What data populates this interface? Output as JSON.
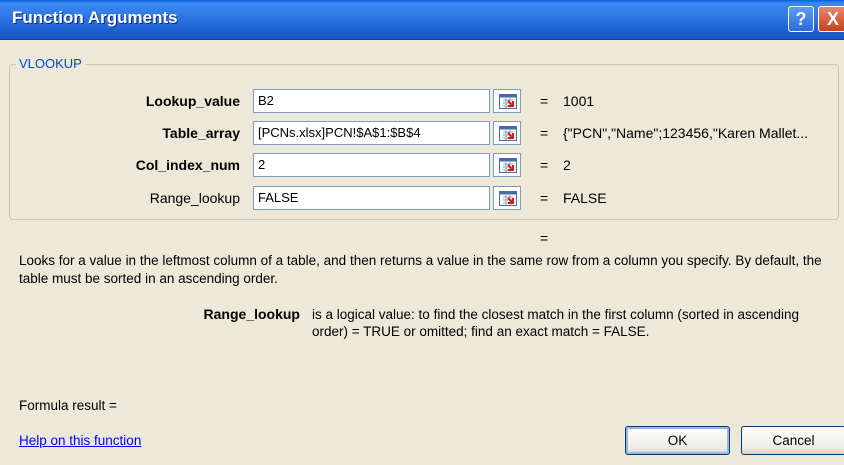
{
  "window": {
    "title": "Function Arguments",
    "help_glyph": "?",
    "close_glyph": "X"
  },
  "group": {
    "legend": "VLOOKUP"
  },
  "args": [
    {
      "label": "Lookup_value",
      "value": "B2",
      "eq": "=",
      "result": "1001"
    },
    {
      "label": "Table_array",
      "value": "[PCNs.xlsx]PCN!$A$1:$B$4",
      "eq": "=",
      "result": "{\"PCN\",\"Name\";123456,\"Karen Mallet..."
    },
    {
      "label": "Col_index_num",
      "value": "2",
      "eq": "=",
      "result": "2"
    },
    {
      "label": "Range_lookup",
      "value": "FALSE",
      "eq": "=",
      "result": "FALSE"
    }
  ],
  "result_eq": "=",
  "description": "Looks for a value in the leftmost column of a table, and then returns a value in the same row from a column you specify. By default, the table must be sorted in an ascending order.",
  "arg_help": {
    "name": "Range_lookup",
    "text": "is a logical value: to find the closest match in the first column (sorted in ascending order) = TRUE or omitted; find an exact match = FALSE."
  },
  "formula_result_label": "Formula result =",
  "help_link": "Help on this function",
  "buttons": {
    "ok": "OK",
    "cancel": "Cancel"
  },
  "icons": {
    "collapse": "collapse-dialog-icon"
  }
}
